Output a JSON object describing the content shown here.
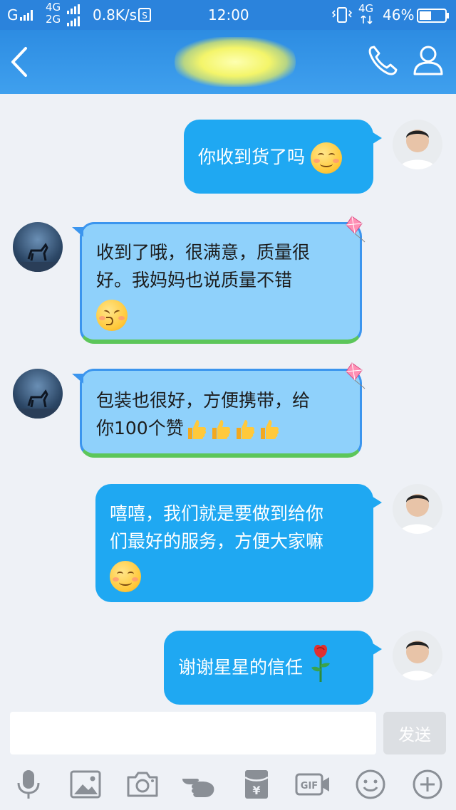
{
  "status_bar": {
    "carrier": "G",
    "net_top": "4G",
    "net_bottom": "2G",
    "speed": "0.8K/s",
    "time": "12:00",
    "net_right": "4G",
    "battery_percent": "46%",
    "battery_level": 0.46
  },
  "header": {
    "back_icon": "chevron-left-icon",
    "title_obscured": true,
    "call_icon": "phone-icon",
    "profile_icon": "person-icon",
    "color": "#3a9cec"
  },
  "messages": [
    {
      "sender": "me",
      "lines": [
        "你收到货了吗"
      ],
      "emoji": "smile"
    },
    {
      "sender": "them",
      "lines": [
        "收到了哦，很满意，质量很",
        "好。我妈妈也说质量不错"
      ],
      "emoji": "kiss"
    },
    {
      "sender": "them",
      "lines": [
        "包装也很好，方便携带，给",
        "你100个赞"
      ],
      "emoji": "thumbs-up",
      "emoji_count": 4
    },
    {
      "sender": "me",
      "lines": [
        "嘻嘻，我们就是要做到给你",
        "们最好的服务，方便大家嘛"
      ],
      "emoji": "smile"
    },
    {
      "sender": "me",
      "lines": [
        "谢谢星星的信任"
      ],
      "emoji": "rose"
    }
  ],
  "input": {
    "value": "",
    "send_label": "发送"
  },
  "toolbar": {
    "icons": [
      "microphone-icon",
      "image-icon",
      "camera-icon",
      "poke-hand-icon",
      "red-packet-icon",
      "gif-icon",
      "emoji-icon",
      "plus-icon"
    ],
    "gif_label": "GIF",
    "packet_label": "¥"
  },
  "colors": {
    "my_bubble": "#1fa8f2",
    "their_bubble": "#8fd1fb",
    "their_bubble_border": "#3b95ee",
    "chat_bg": "#eef1f6"
  }
}
